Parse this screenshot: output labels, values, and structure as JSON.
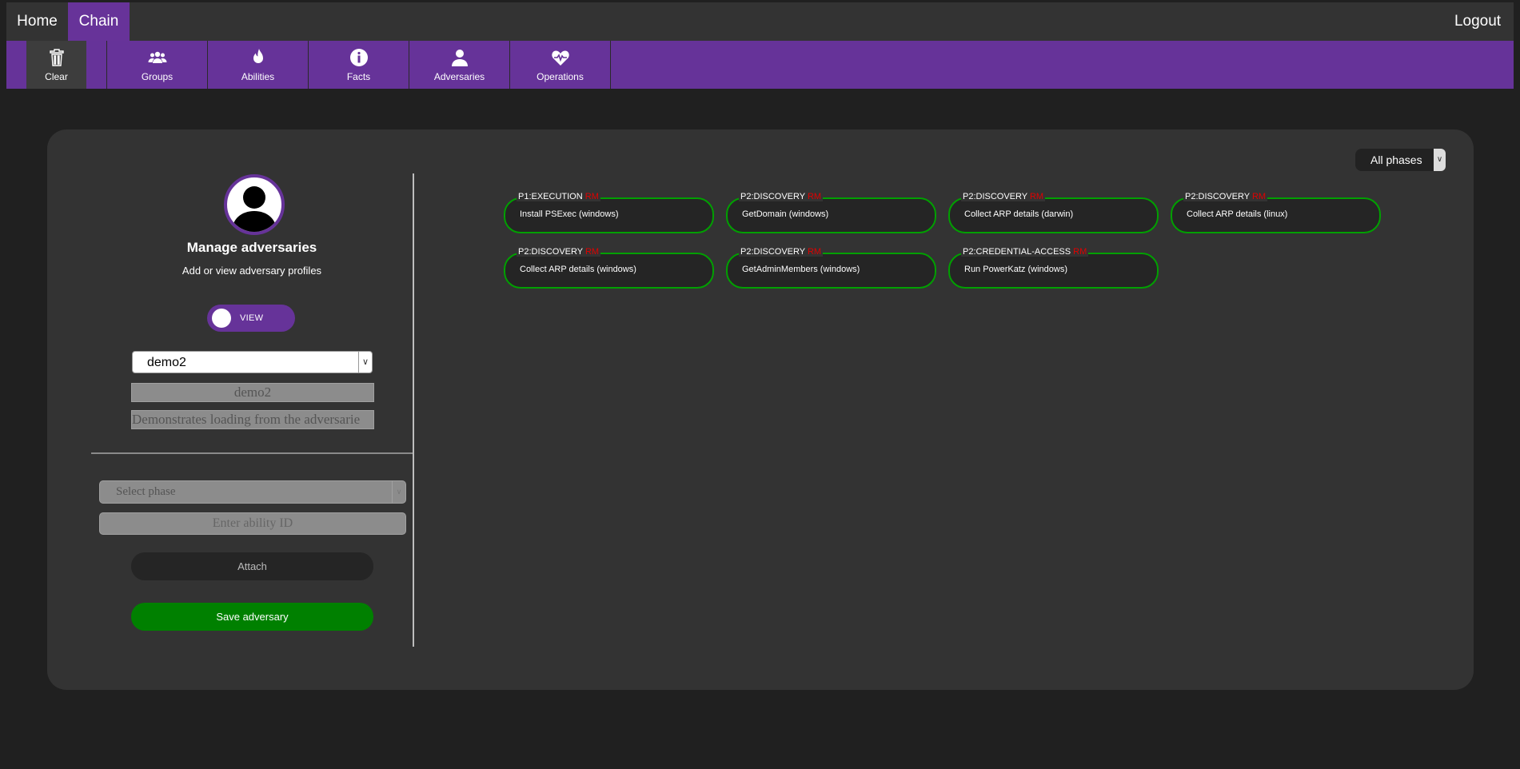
{
  "nav": {
    "home": "Home",
    "chain": "Chain",
    "logout": "Logout"
  },
  "toolbar": {
    "clear": "Clear",
    "groups": "Groups",
    "abilities": "Abilities",
    "facts": "Facts",
    "adversaries": "Adversaries",
    "operations": "Operations"
  },
  "sidebar": {
    "title": "Manage adversaries",
    "subtitle": "Add or view adversary profiles",
    "toggle_label": "VIEW",
    "selected_adversary": "demo2",
    "name_value": "demo2",
    "description_value": "Demonstrates loading from the adversarie",
    "phase_placeholder": "Select phase",
    "ability_placeholder": "Enter ability ID",
    "attach_label": "Attach",
    "save_label": "Save adversary"
  },
  "phase_filter": "All phases",
  "abilities": [
    {
      "phase": "P1:EXECUTION",
      "rm": "RM",
      "name": "Install PSExec (windows)"
    },
    {
      "phase": "P2:DISCOVERY",
      "rm": "RM",
      "name": "GetDomain (windows)"
    },
    {
      "phase": "P2:DISCOVERY",
      "rm": "RM",
      "name": "Collect ARP details (darwin)"
    },
    {
      "phase": "P2:DISCOVERY",
      "rm": "RM",
      "name": "Collect ARP details (linux)"
    },
    {
      "phase": "P2:DISCOVERY",
      "rm": "RM",
      "name": "Collect ARP details (windows)"
    },
    {
      "phase": "P2:DISCOVERY",
      "rm": "RM",
      "name": "GetAdminMembers (windows)"
    },
    {
      "phase": "P2:CREDENTIAL-ACCESS",
      "rm": "RM",
      "name": "Run PowerKatz (windows)"
    }
  ],
  "colors": {
    "accent": "#663399",
    "success": "#008000",
    "border_green": "#00a000",
    "rm_red": "#e00000"
  }
}
